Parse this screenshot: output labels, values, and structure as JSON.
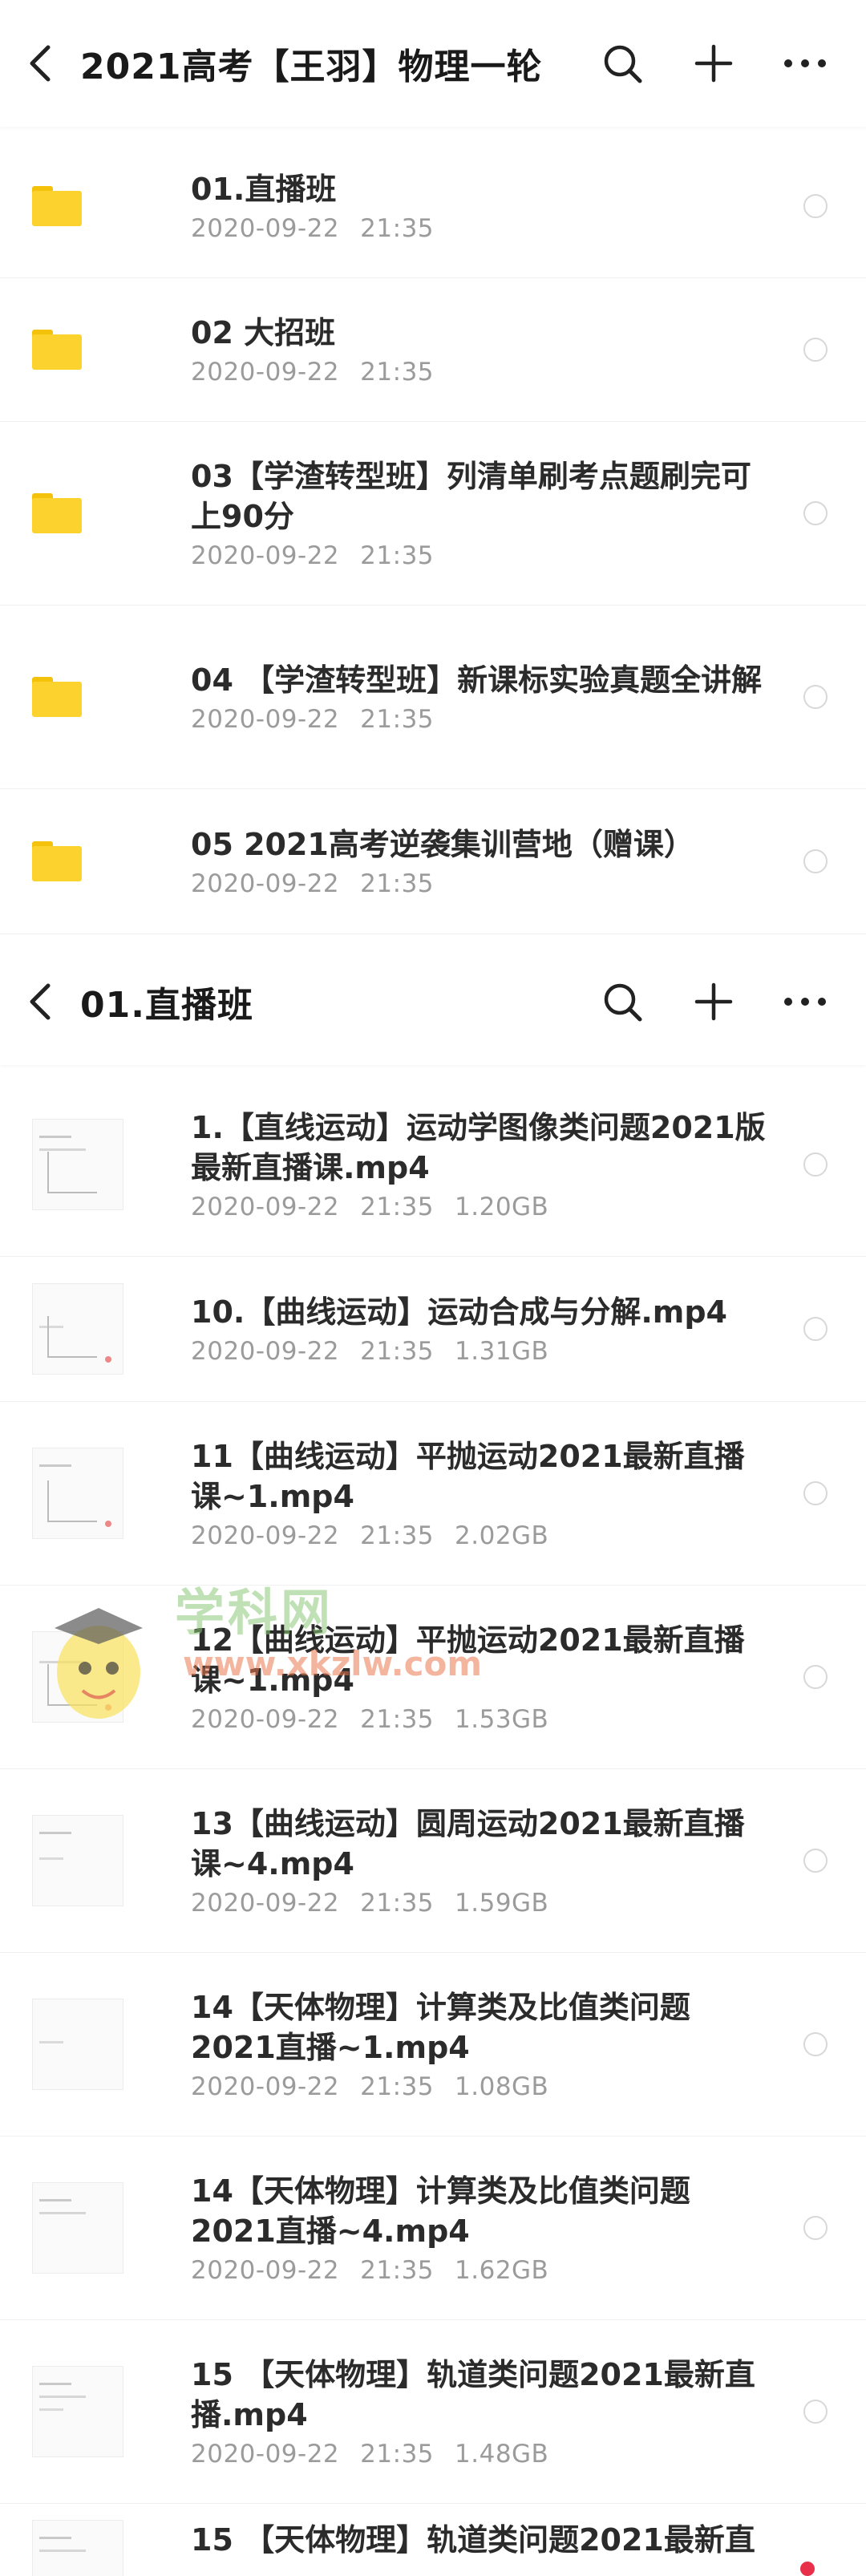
{
  "screen1": {
    "title": "2021高考【王羽】物理一轮",
    "items": [
      {
        "name": "01.直播班",
        "date": "2020-09-22",
        "time": "21:35"
      },
      {
        "name": "02 大招班",
        "date": "2020-09-22",
        "time": "21:35"
      },
      {
        "name": "03【学渣转型班】列清单刷考点题刷完可上90分",
        "date": "2020-09-22",
        "time": "21:35"
      },
      {
        "name": "04 【学渣转型班】新课标实验真题全讲解",
        "date": "2020-09-22",
        "time": "21:35"
      },
      {
        "name": "05 2021高考逆袭集训营地（赠课）",
        "date": "2020-09-22",
        "time": "21:35"
      }
    ]
  },
  "screen2": {
    "title": "01.直播班",
    "items": [
      {
        "name": "1.【直线运动】运动学图像类问题2021版最新直播课.mp4",
        "date": "2020-09-22",
        "time": "21:35",
        "size": "1.20GB"
      },
      {
        "name": "10.【曲线运动】运动合成与分解.mp4",
        "date": "2020-09-22",
        "time": "21:35",
        "size": "1.31GB"
      },
      {
        "name": "11【曲线运动】平抛运动2021最新直播课~1.mp4",
        "date": "2020-09-22",
        "time": "21:35",
        "size": "2.02GB"
      },
      {
        "name": "12【曲线运动】平抛运动2021最新直播课~1.mp4",
        "date": "2020-09-22",
        "time": "21:35",
        "size": "1.53GB"
      },
      {
        "name": "13【曲线运动】圆周运动2021最新直播课~4.mp4",
        "date": "2020-09-22",
        "time": "21:35",
        "size": "1.59GB"
      },
      {
        "name": "14【天体物理】计算类及比值类问题2021直播~1.mp4",
        "date": "2020-09-22",
        "time": "21:35",
        "size": "1.08GB"
      },
      {
        "name": "14【天体物理】计算类及比值类问题2021直播~4.mp4",
        "date": "2020-09-22",
        "time": "21:35",
        "size": "1.62GB"
      },
      {
        "name": "15 【天体物理】轨道类问题2021最新直播.mp4",
        "date": "2020-09-22",
        "time": "21:35",
        "size": "1.48GB"
      },
      {
        "name": "15 【天体物理】轨道类问题2021最新直",
        "date": "",
        "time": "",
        "size": ""
      }
    ]
  },
  "icons": {
    "back": "chevron-left-icon",
    "search": "search-icon",
    "add": "plus-icon",
    "more": "more-horizontal-icon",
    "folder": "folder-icon",
    "video": "video-thumbnail"
  },
  "colors": {
    "folder": "#fbd22e",
    "text": "#2b2b2b",
    "meta": "#9b9b9b",
    "accent": "#e8304b"
  },
  "watermark": {
    "line1": "学科网",
    "line2": "www.xkzlw.com"
  }
}
